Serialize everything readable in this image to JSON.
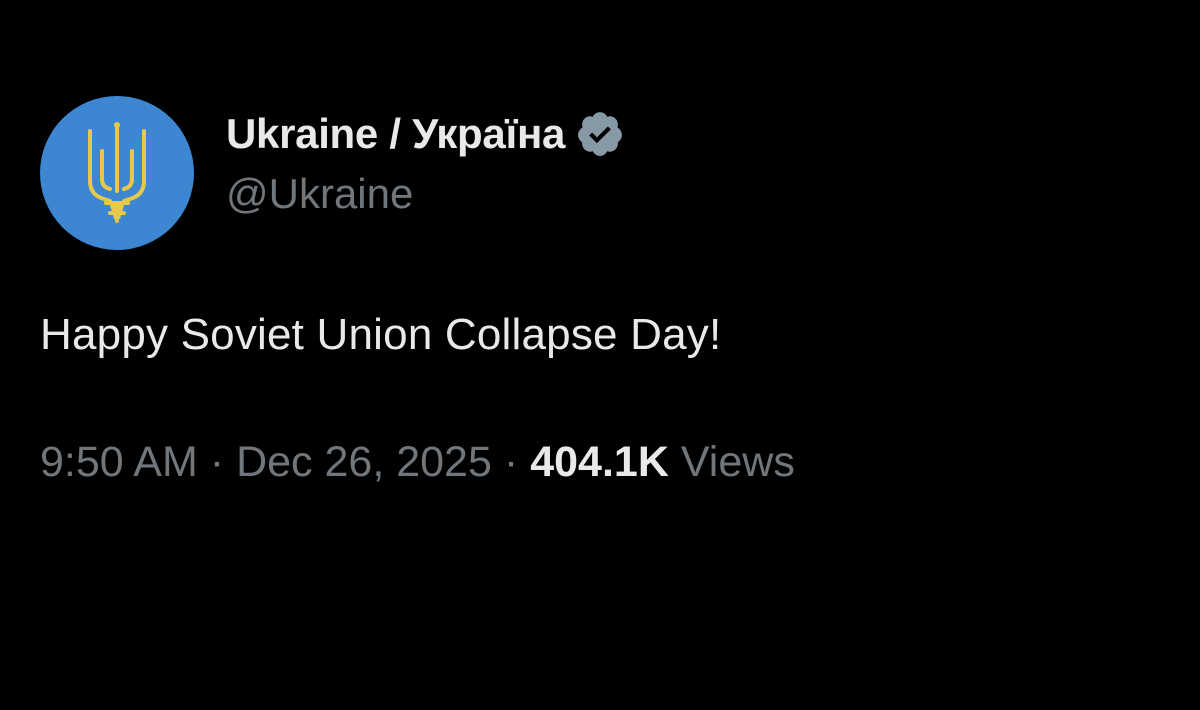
{
  "tweet": {
    "author": {
      "display_name": "Ukraine / Україна",
      "handle": "@Ukraine",
      "verified": true,
      "avatar_icon": "trident-icon",
      "avatar_color": "#3d86d1"
    },
    "text": "Happy Soviet Union Collapse Day!",
    "meta": {
      "time": "9:50 AM",
      "separator": "·",
      "date": "Dec 26, 2025",
      "views_count": "404.1K",
      "views_label": "Views"
    }
  },
  "colors": {
    "background": "#000000",
    "primary_text": "#e7e9ea",
    "secondary_text": "#71767b",
    "verified_badge": "#8899a6",
    "trident": "#e8c84a"
  }
}
